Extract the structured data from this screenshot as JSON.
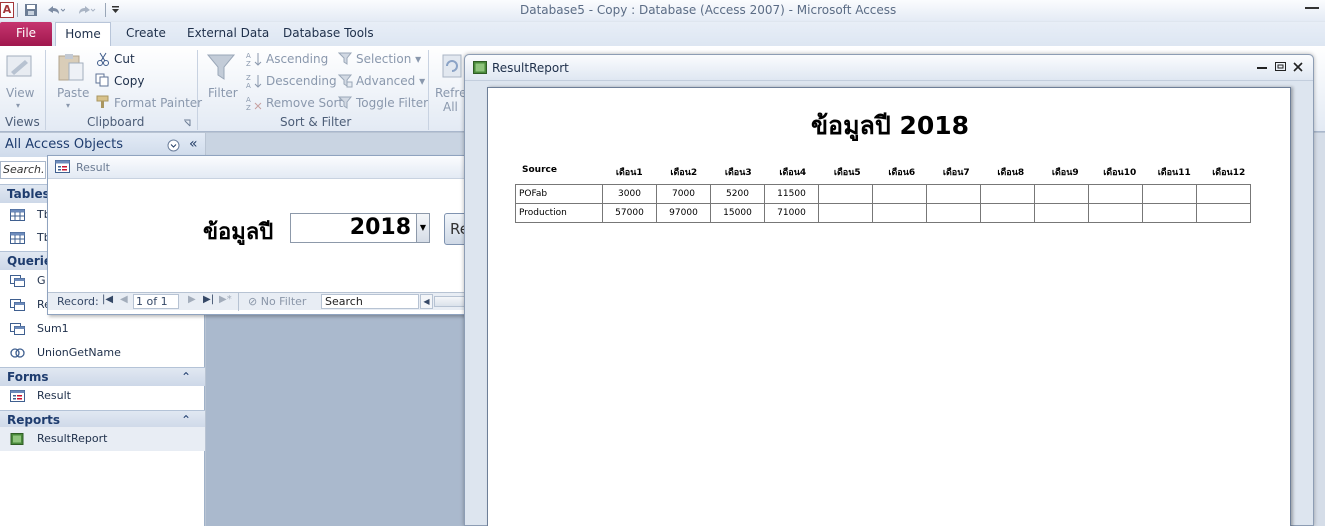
{
  "app": {
    "icon_letter": "A",
    "window_title": "Database5 - Copy : Database (Access 2007)  -  Microsoft Access"
  },
  "quick_access": {
    "save_icon": "save-icon",
    "undo_icon": "undo-icon",
    "redo_icon": "redo-icon",
    "customize_icon": "qat-customize-icon"
  },
  "ribbon_tabs": [
    "File",
    "Home",
    "Create",
    "External Data",
    "Database Tools"
  ],
  "ribbon": {
    "view": {
      "label": "View",
      "group": "Views"
    },
    "clipboard": {
      "paste": "Paste",
      "cut": "Cut",
      "copy": "Copy",
      "format_painter": "Format Painter",
      "group": "Clipboard"
    },
    "sort_filter": {
      "filter": "Filter",
      "ascending": "Ascending",
      "descending": "Descending",
      "remove_sort": "Remove Sort",
      "selection": "Selection",
      "advanced": "Advanced",
      "toggle_filter": "Toggle Filter",
      "group": "Sort & Filter"
    },
    "records": {
      "refresh_line1": "Refre",
      "refresh_line2": "All"
    }
  },
  "nav_pane": {
    "header": "All Access Objects",
    "search_placeholder": "Search...",
    "sections": {
      "tables": {
        "label": "Tables",
        "items": [
          "Tb",
          "Tb"
        ]
      },
      "queries": {
        "label": "Querie",
        "items": [
          "G",
          "Re",
          "Sum1",
          "UnionGetName"
        ]
      },
      "forms": {
        "label": "Forms",
        "items": [
          "Result"
        ]
      },
      "reports": {
        "label": "Reports",
        "items": [
          "ResultReport"
        ]
      }
    }
  },
  "form_window": {
    "title": "Result",
    "year_label": "ข้อมูลปี",
    "year_value": "2018",
    "button_label": "Re",
    "record_nav": {
      "label": "Record:",
      "position": "1 of 1",
      "filter": "No Filter",
      "search": "Search"
    }
  },
  "report_window": {
    "title": "ResultReport",
    "heading": "ข้อมูลปี 2018",
    "columns": [
      "Source",
      "เดือน1",
      "เดือน2",
      "เดือน3",
      "เดือน4",
      "เดือน5",
      "เดือน6",
      "เดือน7",
      "เดือน8",
      "เดือน9",
      "เดือน10",
      "เดือน11",
      "เดือน12"
    ],
    "rows": [
      [
        "POFab",
        "3000",
        "7000",
        "5200",
        "11500",
        "",
        "",
        "",
        "",
        "",
        "",
        "",
        ""
      ],
      [
        "Production",
        "57000",
        "97000",
        "15000",
        "71000",
        "",
        "",
        "",
        "",
        "",
        "",
        "",
        ""
      ]
    ]
  }
}
